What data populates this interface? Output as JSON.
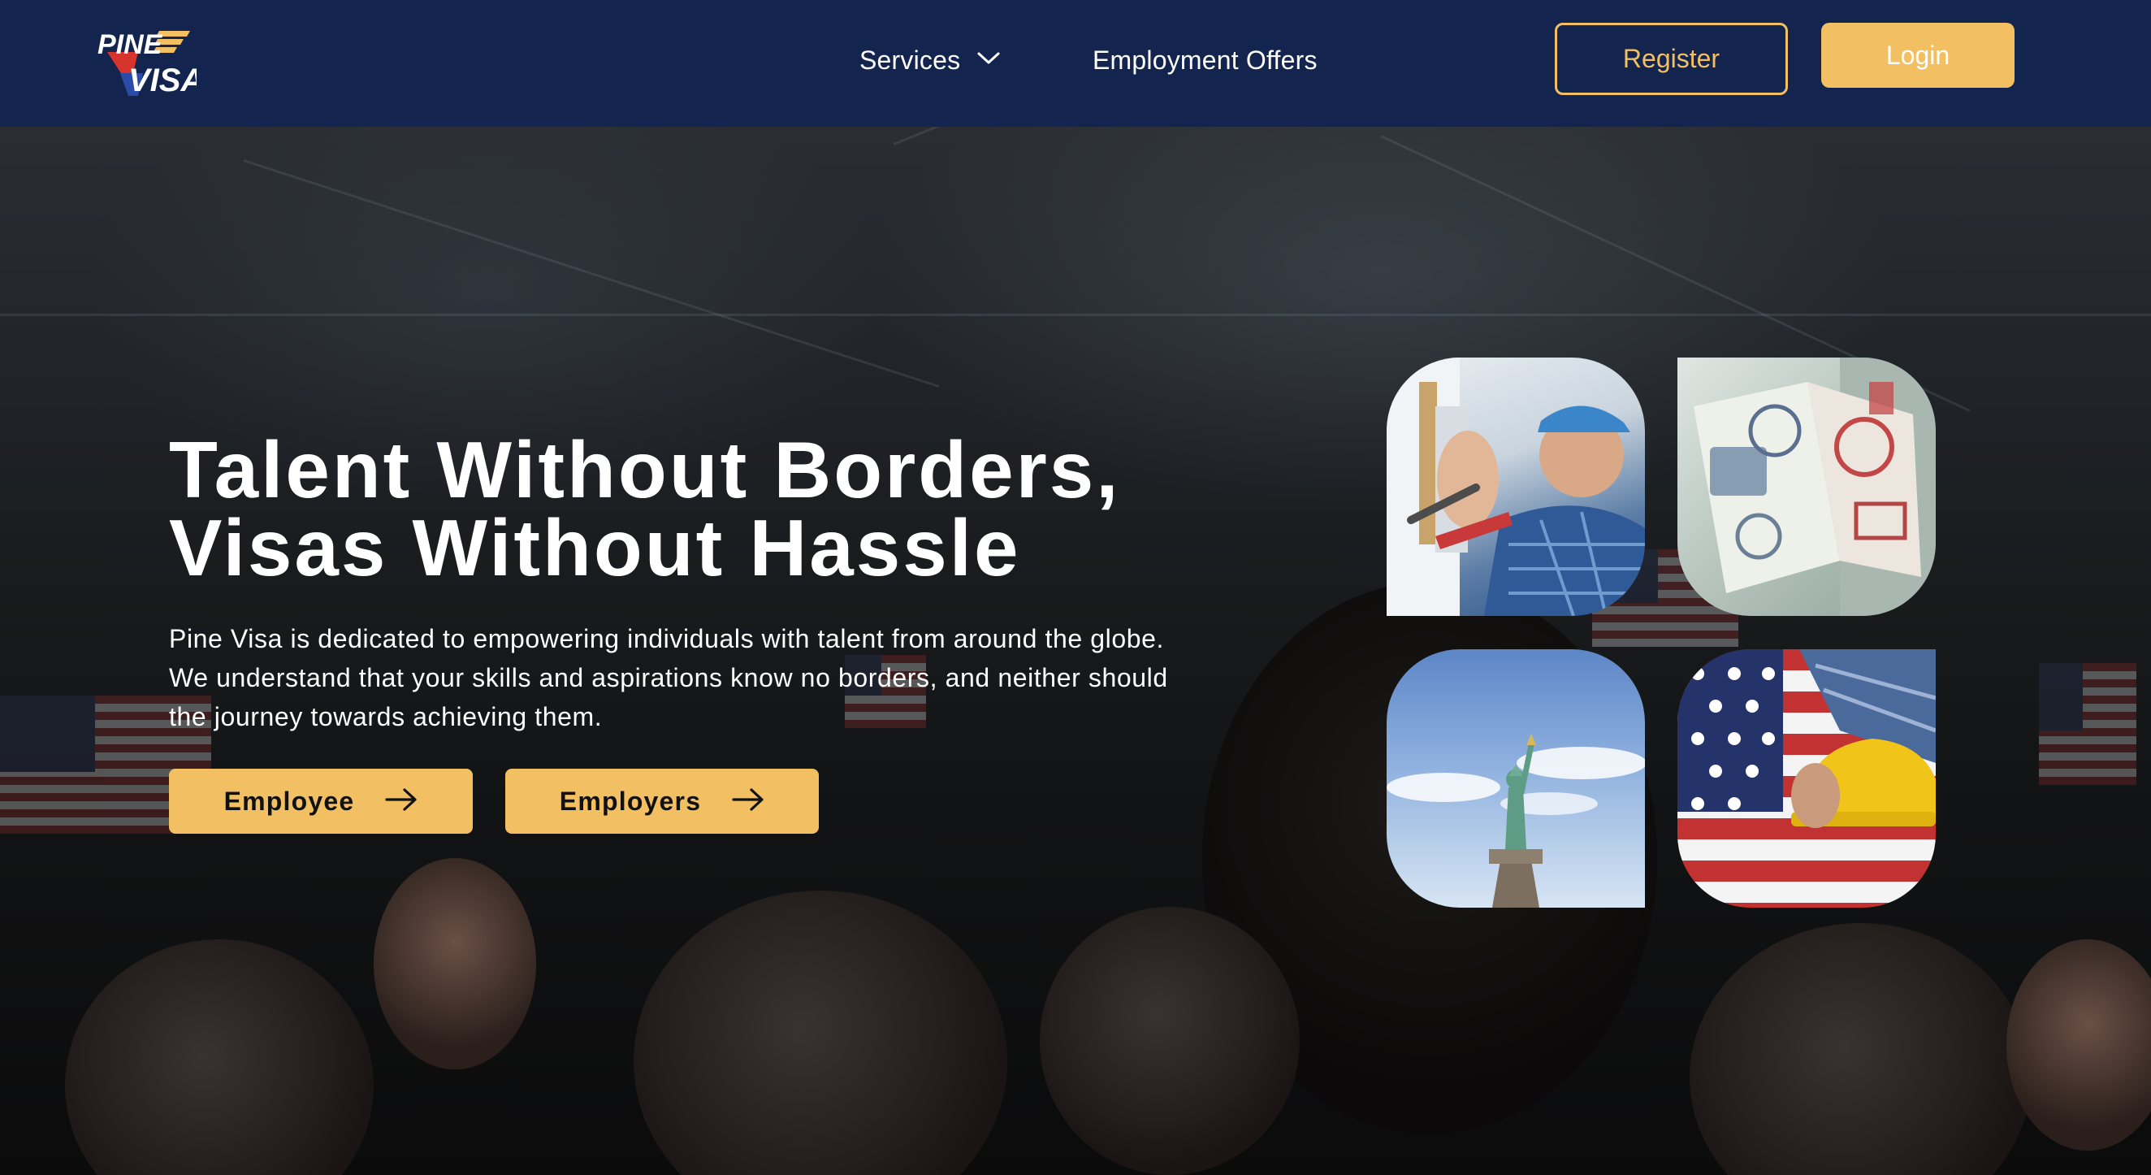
{
  "header": {
    "logo": {
      "line1": "PINE",
      "line2": "VISA",
      "icon": "pine-visa-logo"
    },
    "nav": {
      "services_label": "Services",
      "services_icon": "chevron-down-icon",
      "employment_offers_label": "Employment Offers"
    },
    "register_label": "Register",
    "login_label": "Login"
  },
  "hero": {
    "title_line1": "Talent Without Borders,",
    "title_line2": "Visas Without Hassle",
    "description": "Pine Visa is dedicated to empowering individuals with talent from around the globe. We understand that your skills and aspirations know no borders, and neither should the journey towards achieving them.",
    "buttons": [
      {
        "label": "Employee",
        "icon": "arrow-right-icon"
      },
      {
        "label": "Employers",
        "icon": "arrow-right-icon"
      }
    ],
    "images": [
      {
        "name": "worker-with-wrench-photo"
      },
      {
        "name": "passport-stamps-photo"
      },
      {
        "name": "statue-of-liberty-photo"
      },
      {
        "name": "american-flag-hard-hat-photo"
      }
    ]
  },
  "colors": {
    "navbar_bg": "#13244f",
    "accent_gold": "#f2c063",
    "text_white": "#ffffff",
    "logo_red": "#d8342e",
    "logo_blue": "#2a4ba8"
  }
}
